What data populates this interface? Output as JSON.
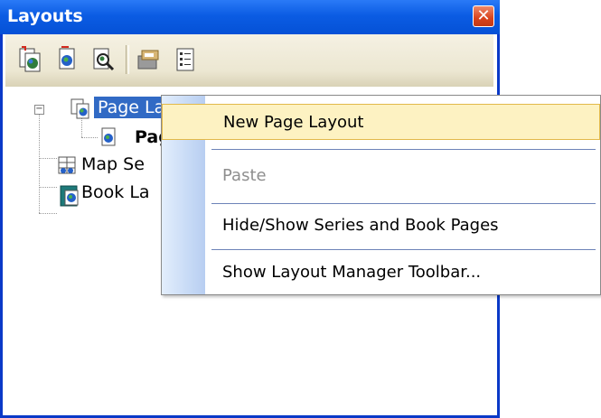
{
  "panel": {
    "title": "Layouts",
    "close_glyph": "✕"
  },
  "toolbar": {
    "buttons": [
      {
        "icon": "new-layout-icon"
      },
      {
        "icon": "new-page-icon"
      },
      {
        "icon": "preview-icon"
      },
      {
        "icon": "properties-icon"
      },
      {
        "icon": "list-view-icon"
      }
    ]
  },
  "tree": {
    "nodes": [
      {
        "label": "Page Layouts",
        "visible": "Page La",
        "selected": true
      },
      {
        "label": "Page",
        "visible": "Pag",
        "bold": true
      },
      {
        "label": "Map Series",
        "visible": "Map Se"
      },
      {
        "label": "Book Layouts",
        "visible": "Book La"
      }
    ]
  },
  "context_menu": {
    "items": [
      {
        "label": "New Page Layout",
        "highlighted": true
      },
      {
        "label": "Paste",
        "disabled": true
      },
      {
        "label": "Hide/Show Series and Book Pages"
      },
      {
        "label": "Show Layout Manager Toolbar..."
      }
    ]
  },
  "colors": {
    "titlebar": "#0b5ce3",
    "selection": "#316ac5",
    "menu_highlight": "#fdf2c2"
  }
}
